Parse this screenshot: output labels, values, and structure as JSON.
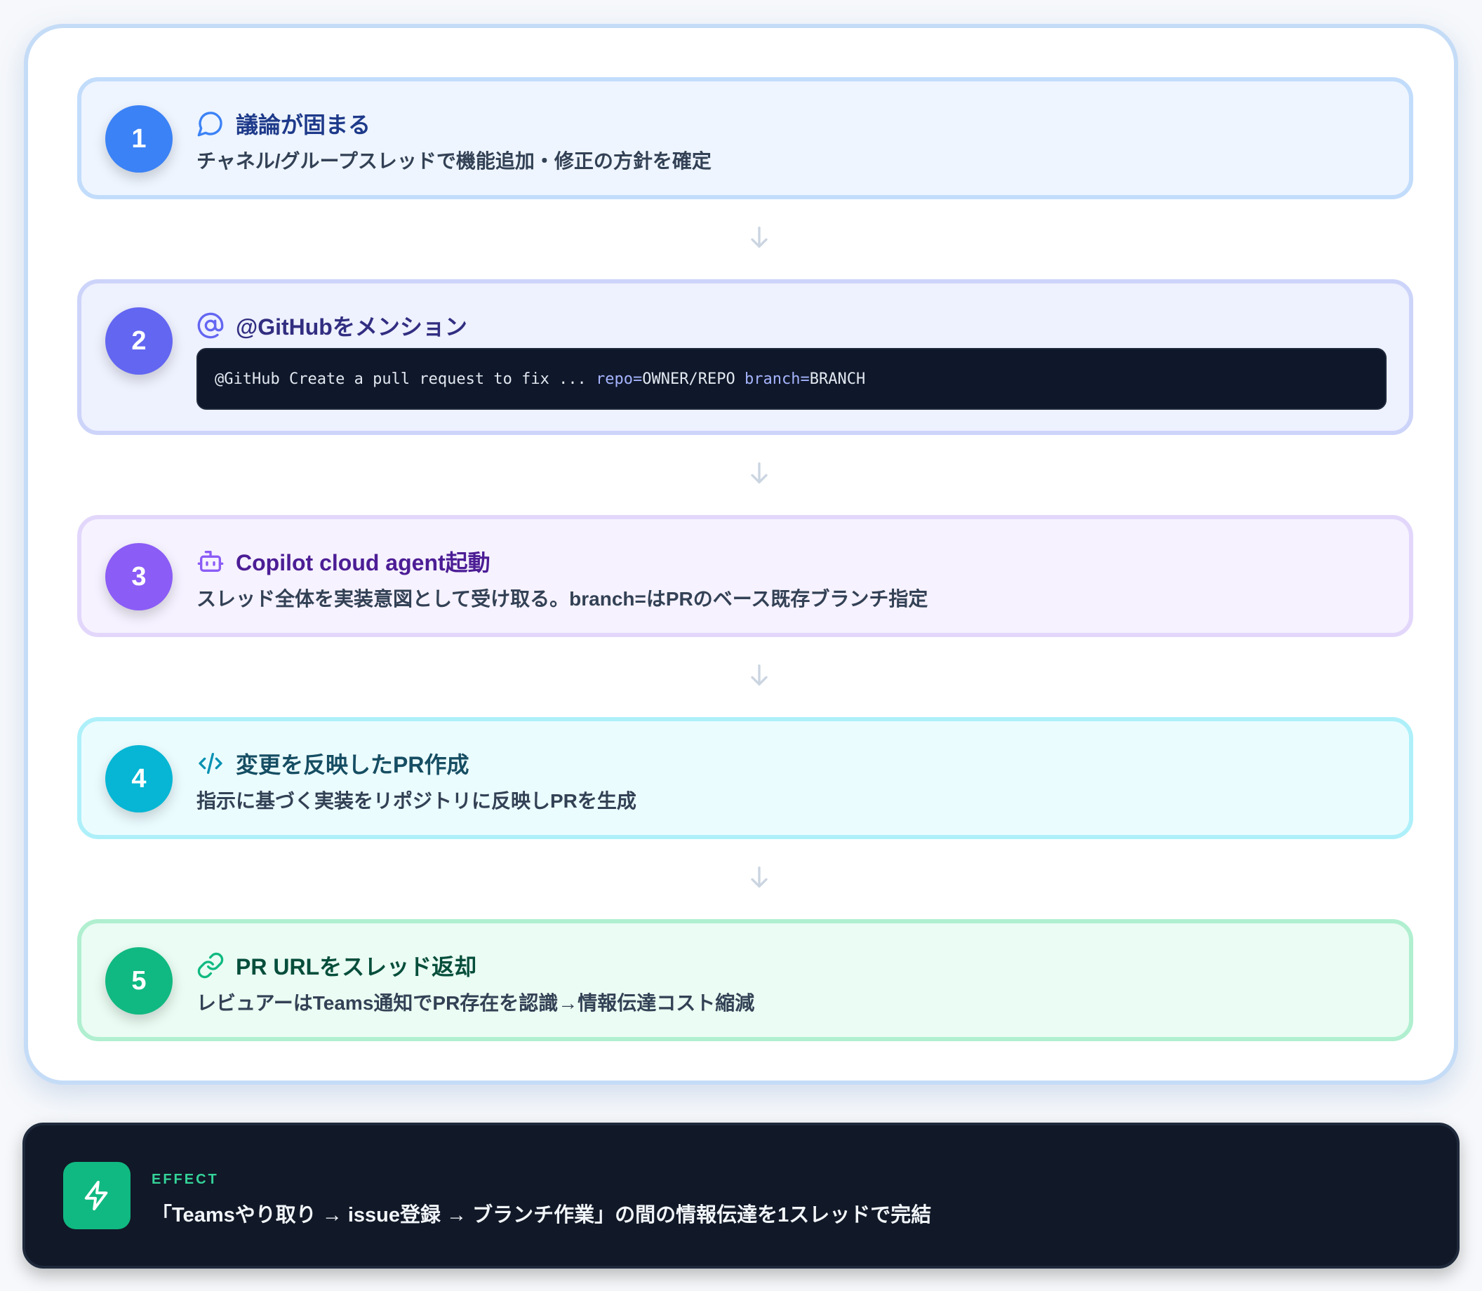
{
  "steps": [
    {
      "number": "1",
      "icon": "chat-bubble-icon",
      "title": "議論が固まる",
      "description": "チャネル/グループスレッドで機能追加・修正の方針を確定"
    },
    {
      "number": "2",
      "icon": "at-sign-icon",
      "title": "@GitHubをメンション",
      "code": {
        "prefix": "@GitHub Create a pull request to fix ... ",
        "repo_key": "repo=",
        "repo_value": "OWNER/REPO ",
        "branch_key": "branch=",
        "branch_value": "BRANCH"
      }
    },
    {
      "number": "3",
      "icon": "robot-icon",
      "title": "Copilot cloud agent起動",
      "description": "スレッド全体を実装意図として受け取る。branch=はPRのベース既存ブランチ指定"
    },
    {
      "number": "4",
      "icon": "code-brackets-icon",
      "title": "変更を反映したPR作成",
      "description": "指示に基づく実装をリポジトリに反映しPRを生成"
    },
    {
      "number": "5",
      "icon": "link-icon",
      "title": "PR URLをスレッド返却",
      "description": "レビュアーはTeams通知でPR存在を認識→情報伝達コスト縮減"
    }
  ],
  "effect": {
    "icon": "lightning-icon",
    "label": "EFFECT",
    "text": "「Teamsやり取り → issue登録 → ブランチ作業」の間の情報伝達を1スレッドで完結"
  },
  "colors": {
    "step1": "#3b82f6",
    "step2": "#6366f1",
    "step3": "#8b5cf6",
    "step4": "#06b6d4",
    "step5": "#10b981",
    "effect_bg": "#111827",
    "effect_accent": "#34d399"
  }
}
